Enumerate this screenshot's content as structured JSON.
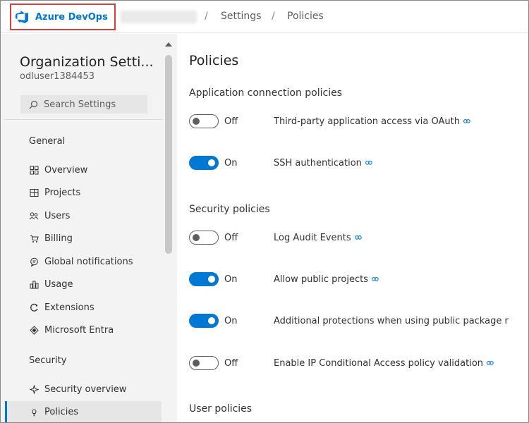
{
  "colors": {
    "accent": "#0078d4",
    "highlight_border": "#e03b3b",
    "sidebar_bg": "#f3f3f3"
  },
  "header": {
    "brand": "Azure DevOps",
    "breadcrumbs": [
      "Settings",
      "Policies"
    ],
    "separator": "/"
  },
  "sidebar": {
    "title": "Organization Setti...",
    "user": "odluser1384453",
    "search_placeholder": "Search Settings",
    "sections": [
      {
        "label": "General",
        "items": [
          {
            "label": "Overview",
            "icon": "overview-icon"
          },
          {
            "label": "Projects",
            "icon": "projects-icon"
          },
          {
            "label": "Users",
            "icon": "users-icon"
          },
          {
            "label": "Billing",
            "icon": "billing-icon"
          },
          {
            "label": "Global notifications",
            "icon": "notifications-icon"
          },
          {
            "label": "Usage",
            "icon": "usage-icon"
          },
          {
            "label": "Extensions",
            "icon": "extensions-icon"
          },
          {
            "label": "Microsoft Entra",
            "icon": "entra-icon"
          }
        ]
      },
      {
        "label": "Security",
        "items": [
          {
            "label": "Security overview",
            "icon": "security-overview-icon"
          },
          {
            "label": "Policies",
            "icon": "policies-icon",
            "selected": true
          }
        ]
      }
    ]
  },
  "main": {
    "title": "Policies",
    "groups": [
      {
        "title": "Application connection policies",
        "policies": [
          {
            "state": "Off",
            "enabled": false,
            "label": "Third-party application access via OAuth"
          },
          {
            "state": "On",
            "enabled": true,
            "label": "SSH authentication"
          }
        ]
      },
      {
        "title": "Security policies",
        "policies": [
          {
            "state": "Off",
            "enabled": false,
            "label": "Log Audit Events"
          },
          {
            "state": "On",
            "enabled": true,
            "label": "Allow public projects"
          },
          {
            "state": "On",
            "enabled": true,
            "label": "Additional protections when using public package r"
          },
          {
            "state": "Off",
            "enabled": false,
            "label": "Enable IP Conditional Access policy validation"
          }
        ]
      },
      {
        "title": "User policies",
        "policies": []
      }
    ]
  }
}
